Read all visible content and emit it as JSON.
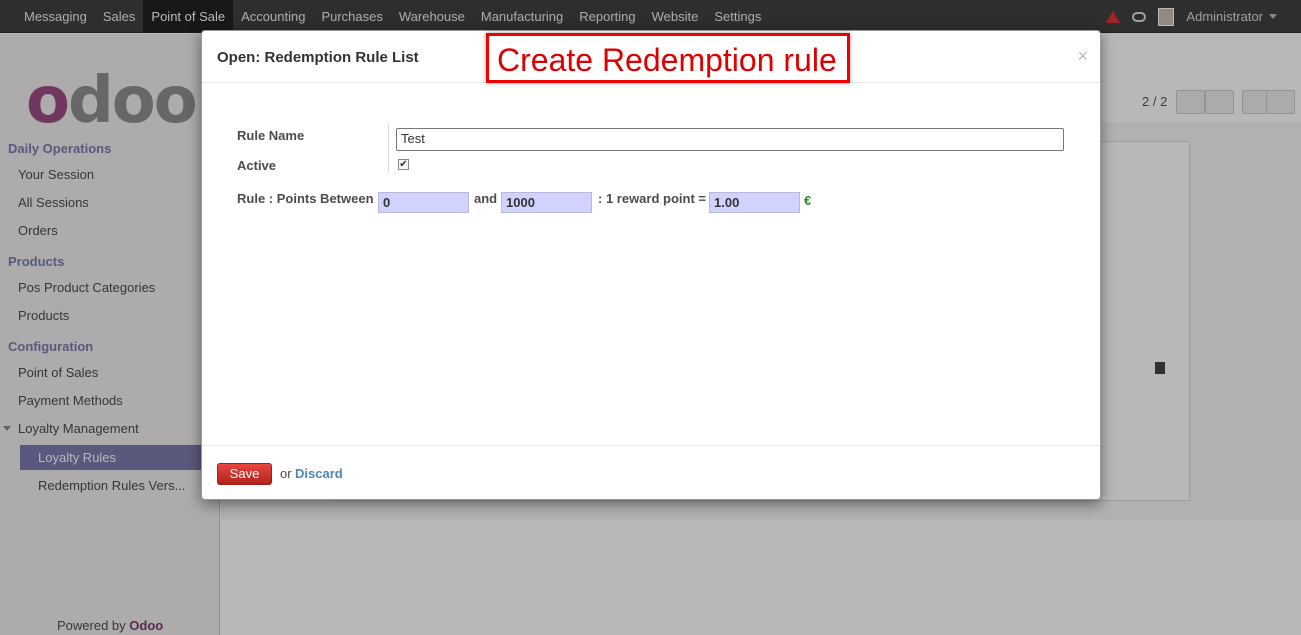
{
  "topbar": {
    "menu": [
      "Messaging",
      "Sales",
      "Point of Sale",
      "Accounting",
      "Purchases",
      "Warehouse",
      "Manufacturing",
      "Reporting",
      "Website",
      "Settings"
    ],
    "active_menu": "Point of Sale",
    "user": "Administrator"
  },
  "sidebar": {
    "logo": "odoo",
    "sections": {
      "daily": "Daily Operations",
      "products": "Products",
      "configuration": "Configuration"
    },
    "items": {
      "your_session": "Your Session",
      "all_sessions": "All Sessions",
      "orders": "Orders",
      "pos_categories": "Pos Product Categories",
      "products": "Products",
      "point_of_sales": "Point of Sales",
      "payment_methods": "Payment Methods",
      "loyalty_management": "Loyalty Management",
      "loyalty_rules": "Loyalty Rules",
      "redemption_rules": "Redemption Rules Vers..."
    },
    "powered_prefix": "Powered by",
    "powered_brand": "Odoo"
  },
  "pager": "2 / 2",
  "modal": {
    "title": "Open: Redemption Rule List",
    "annotation": "Create Redemption rule",
    "close_glyph": "×",
    "rule_name_label": "Rule Name",
    "rule_name_value": "Test",
    "active_label": "Active",
    "active_checked": true,
    "points_between_label": "Rule : Points Between",
    "points_from": "0",
    "and_label": "and",
    "points_to": "1000",
    "reward_label": ": 1 reward point =",
    "reward_value": "1.00",
    "currency": "€",
    "save_label": "Save",
    "or_label": "or",
    "discard_label": "Discard"
  }
}
